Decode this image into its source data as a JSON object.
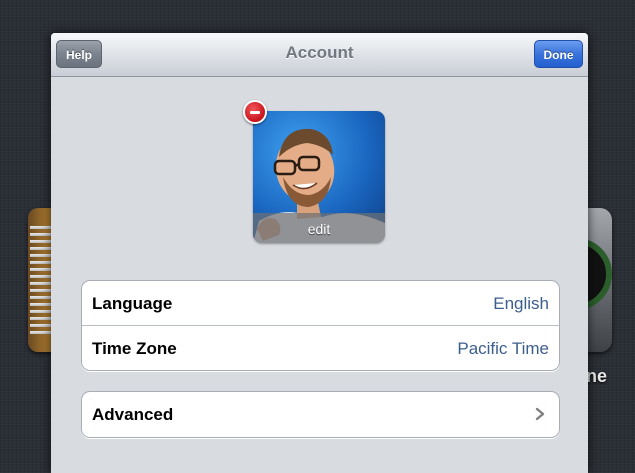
{
  "background": {
    "partial_app_label": "ne"
  },
  "nav": {
    "title": "Account",
    "help_label": "Help",
    "done_label": "Done"
  },
  "avatar": {
    "edit_label": "edit"
  },
  "settings": {
    "rows": [
      {
        "label": "Language",
        "value": "English"
      },
      {
        "label": "Time Zone",
        "value": "Pacific Time"
      }
    ],
    "advanced": {
      "label": "Advanced"
    }
  },
  "colors": {
    "done_button": "#2f6ad8",
    "help_button": "#7b838e",
    "delete_badge": "#c8131b",
    "value_text": "#3c5e8c"
  }
}
